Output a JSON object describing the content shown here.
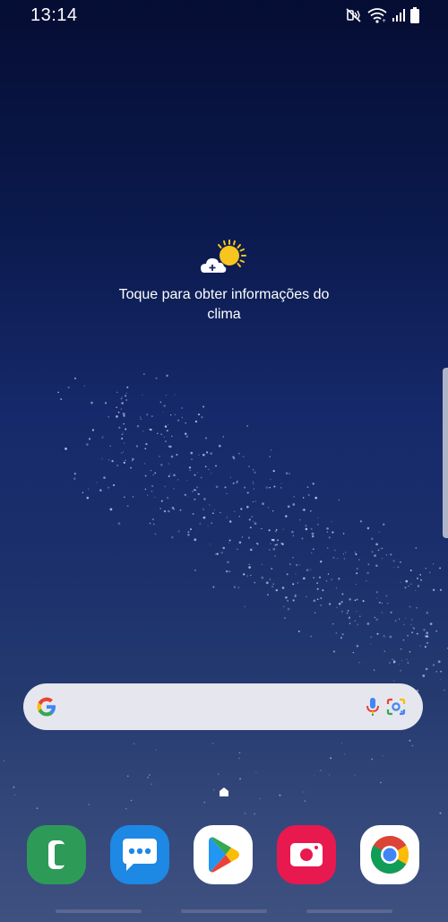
{
  "status_bar": {
    "time": "13:14",
    "icons": [
      "mute-vibrate-icon",
      "wifi-icon",
      "cellular-signal-icon",
      "battery-icon"
    ]
  },
  "weather_widget": {
    "icon": "partly-sunny-cloud-add-icon",
    "message": "Toque para obter informações do clima"
  },
  "search_bar": {
    "logo": "google-g-icon",
    "mic": "mic-icon",
    "lens": "google-lens-icon"
  },
  "home_indicator": {
    "icon": "home-page-indicator-icon"
  },
  "dock": {
    "apps": [
      {
        "name": "phone",
        "icon": "phone-icon",
        "color": "#2e9a57"
      },
      {
        "name": "messages",
        "icon": "chat-bubble-icon",
        "color": "#1e88e5"
      },
      {
        "name": "play-store",
        "icon": "play-store-icon",
        "color": "#ffffff"
      },
      {
        "name": "camera",
        "icon": "camera-icon",
        "color": "#e8194f"
      },
      {
        "name": "chrome",
        "icon": "chrome-icon",
        "color": "#ffffff"
      }
    ]
  },
  "colors": {
    "background_top": "#050d33",
    "background_bottom": "#3e5180",
    "search_bg": "#e6e7ee"
  }
}
